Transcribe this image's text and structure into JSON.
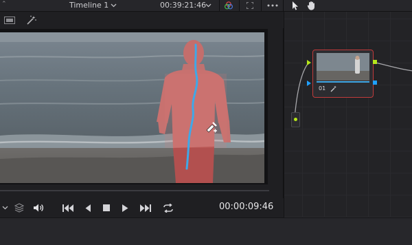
{
  "toolbar": {
    "timeline_name": "Timeline 1",
    "timecode_top": "00:39:21:46"
  },
  "transport": {
    "timecode": "00:00:09:46"
  },
  "node": {
    "label": "01"
  },
  "colors": {
    "panel": "#1f1f22",
    "node_border": "#c23b3b",
    "tracker_line": "#3fa8e8",
    "node_green": "#b6e61a",
    "node_blue": "#1fa0ff"
  },
  "icons": [
    "chevron-down-icon",
    "color-wheel-icon",
    "fullscreen-icon",
    "more-icon",
    "pointer-icon",
    "hand-icon",
    "viewer-icon",
    "magic-wand-icon",
    "cursor-picker-icon",
    "layers-icon",
    "volume-icon",
    "skip-start-icon",
    "prev-frame-icon",
    "stop-icon",
    "play-icon",
    "skip-end-icon",
    "loop-icon"
  ]
}
